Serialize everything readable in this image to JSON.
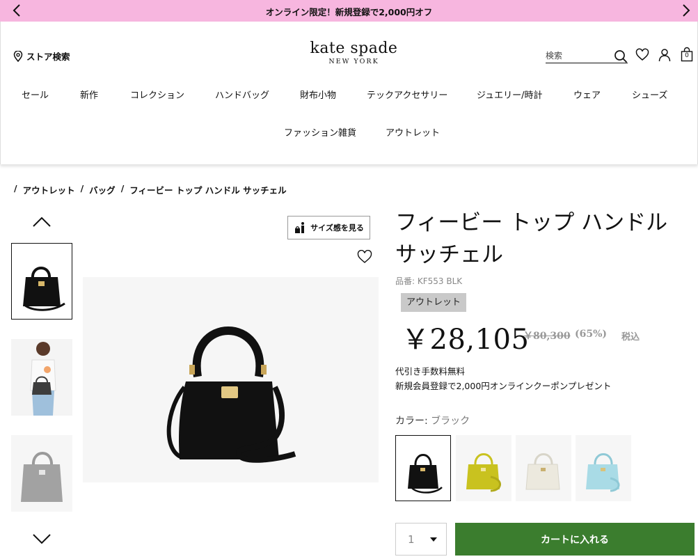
{
  "promo": {
    "text": "オンライン限定！新規登録で2,000円オフ"
  },
  "header": {
    "store_search_label": "ストア検索",
    "logo_main": "kate spade",
    "logo_sub": "NEW YORK",
    "search_placeholder": "検索",
    "cart_count": "0"
  },
  "nav": {
    "items": [
      "セール",
      "新作",
      "コレクション",
      "ハンドバッグ",
      "財布小物",
      "テックアクセサリー",
      "ジュエリー/時計",
      "ウェア",
      "シューズ",
      "ファッション雑貨",
      "アウトレット"
    ]
  },
  "breadcrumb": {
    "sep": "/",
    "items": [
      "アウトレット",
      "バッグ",
      "フィービー トップ ハンドル サッチェル"
    ]
  },
  "gallery": {
    "size_button_label": "サイズ感を見る"
  },
  "product": {
    "title_line1": "フィービー トップ ハンドル",
    "title_line2": "サッチェル",
    "code": "品番: KF553 BLK",
    "badge": "アウトレット",
    "price": "￥28,105",
    "original_price": "￥80,300",
    "discount": "(65%)",
    "tax_label": "税込",
    "note_cod": "代引き手数料無料",
    "note_coupon": "新規会員登録で2,000円オンラインクーポンプレゼント",
    "color_label": "カラー: ",
    "color_value": "ブラック",
    "swatch_colors": [
      "#111111",
      "#c9c21f",
      "#ece9de",
      "#a9dbe6"
    ],
    "quantity": "1",
    "cart_button": "カートに入れる"
  },
  "colors": {
    "promo_bg": "#f7b6df",
    "cart_green": "#3b7d2e",
    "badge_gray": "#c9c9c9"
  }
}
